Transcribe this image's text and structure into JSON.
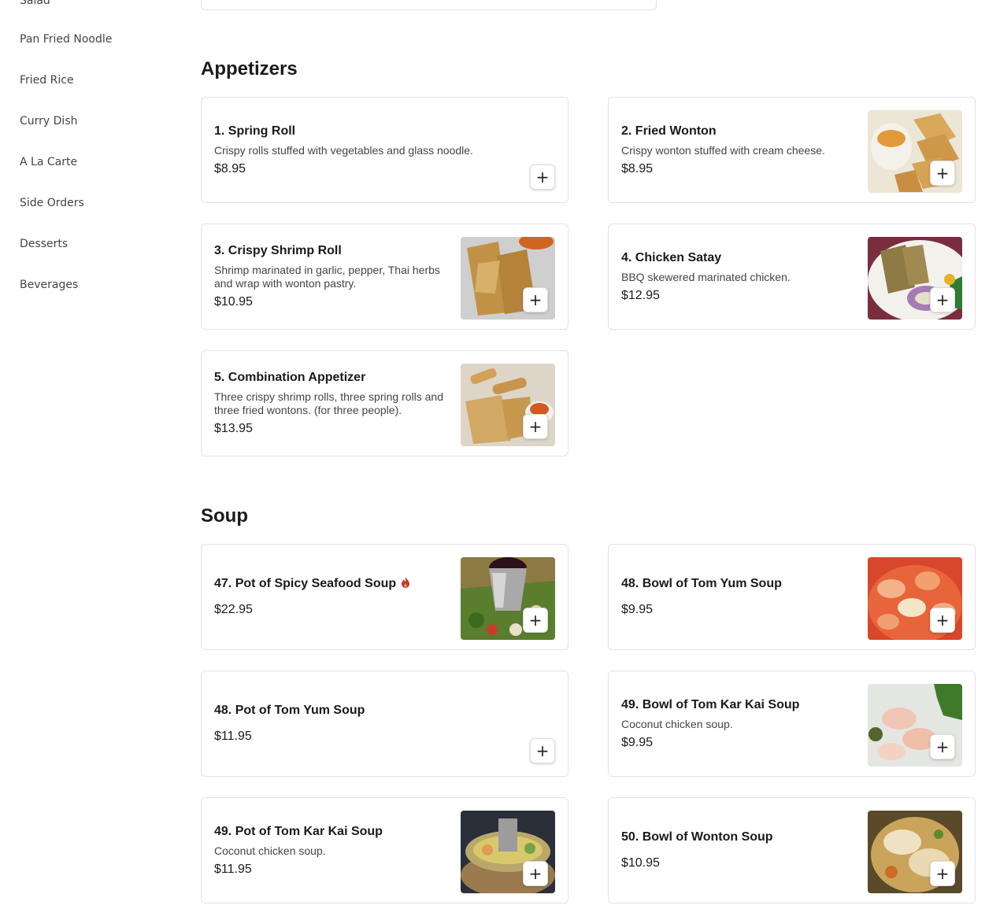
{
  "sidebar": {
    "items": [
      {
        "label": "Salad"
      },
      {
        "label": "Pan Fried Noodle"
      },
      {
        "label": "Fried Rice"
      },
      {
        "label": "Curry Dish"
      },
      {
        "label": "A La Carte"
      },
      {
        "label": "Side Orders"
      },
      {
        "label": "Desserts"
      },
      {
        "label": "Beverages"
      }
    ]
  },
  "sections": [
    {
      "title": "Appetizers",
      "items": [
        {
          "name": "1. Spring Roll",
          "desc": "Crispy rolls stuffed with vegetables and glass noodle.",
          "price": "$8.95",
          "add": "+"
        },
        {
          "name": "2. Fried Wonton",
          "desc": "Crispy wonton stuffed with cream cheese.",
          "price": "$8.95",
          "add": "+"
        },
        {
          "name": "3. Crispy Shrimp Roll",
          "desc": "Shrimp marinated in garlic, pepper, Thai herbs and wrap with wonton pastry.",
          "price": "$10.95",
          "add": "+"
        },
        {
          "name": "4. Chicken Satay",
          "desc": "BBQ skewered marinated chicken.",
          "price": "$12.95",
          "add": "+"
        },
        {
          "name": "5. Combination Appetizer",
          "desc": "Three crispy shrimp rolls, three spring rolls and three fried wontons. (for three people).",
          "price": "$13.95",
          "add": "+"
        }
      ]
    },
    {
      "title": "Soup",
      "items": [
        {
          "name": "47. Pot of Spicy Seafood Soup",
          "price": "$22.95",
          "add": "+",
          "icon": "spicy-icon",
          "icon_color": "#c0392b"
        },
        {
          "name": "48. Bowl of Tom Yum Soup",
          "price": "$9.95",
          "add": "+"
        },
        {
          "name": "48. Pot of Tom Yum Soup",
          "price": "$11.95",
          "add": "+"
        },
        {
          "name": "49. Bowl of Tom Kar Kai Soup",
          "desc": "Coconut chicken soup.",
          "price": "$9.95",
          "add": "+"
        },
        {
          "name": "49. Pot of Tom Kar Kai Soup",
          "desc": "Coconut chicken soup.",
          "price": "$11.95",
          "add": "+"
        },
        {
          "name": "50. Bowl of Wonton Soup",
          "price": "$10.95",
          "add": "+"
        }
      ]
    }
  ]
}
